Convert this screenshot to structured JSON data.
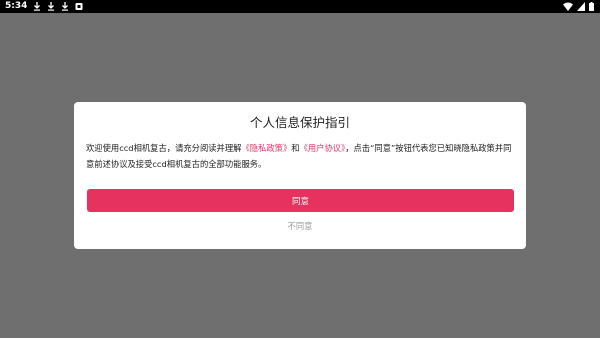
{
  "status_bar": {
    "time": "5:34",
    "left_icons": [
      "download-icon",
      "download-icon",
      "download-icon",
      "notification-icon"
    ],
    "right_icons": [
      "wifi-icon",
      "signal-icon",
      "battery-icon"
    ]
  },
  "dialog": {
    "title": "个人信息保护指引",
    "body": {
      "part1": "欢迎使用ccd相机复古，请充分阅读并理解",
      "privacy_link": "《隐私政策》",
      "part2": "和",
      "terms_link": "《用户协议》",
      "part3": "，点击“同意”按钮代表您已知晓隐私政策并同意前述协议及接受ccd相机复古的全部功能服务。"
    },
    "agree_label": "同意",
    "disagree_label": "不同意"
  },
  "colors": {
    "overlay": "#6f6f6f",
    "accent": "#e5325e",
    "link": "#e8336a"
  }
}
